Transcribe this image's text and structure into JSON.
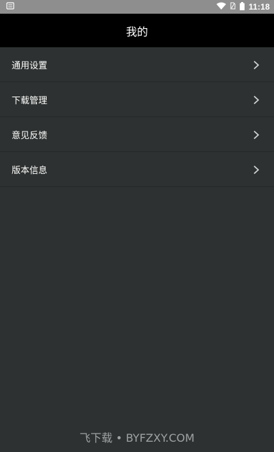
{
  "status_bar": {
    "time": "11:18",
    "left_icon": "notification-icon",
    "icons": [
      "wifi-icon",
      "sim-icon",
      "battery-icon"
    ]
  },
  "header": {
    "title": "我的"
  },
  "menu": {
    "items": [
      {
        "label": "通用设置",
        "icon": "chevron-right-icon"
      },
      {
        "label": "下载管理",
        "icon": "chevron-right-icon"
      },
      {
        "label": "意见反馈",
        "icon": "chevron-right-icon"
      },
      {
        "label": "版本信息",
        "icon": "chevron-right-icon"
      }
    ]
  },
  "watermark": {
    "text": "飞下载 • BYFZXY.COM"
  },
  "colors": {
    "background": "#2e3131",
    "header": "#000000",
    "status_bar": "#8e8e8e",
    "divider": "#252828"
  }
}
